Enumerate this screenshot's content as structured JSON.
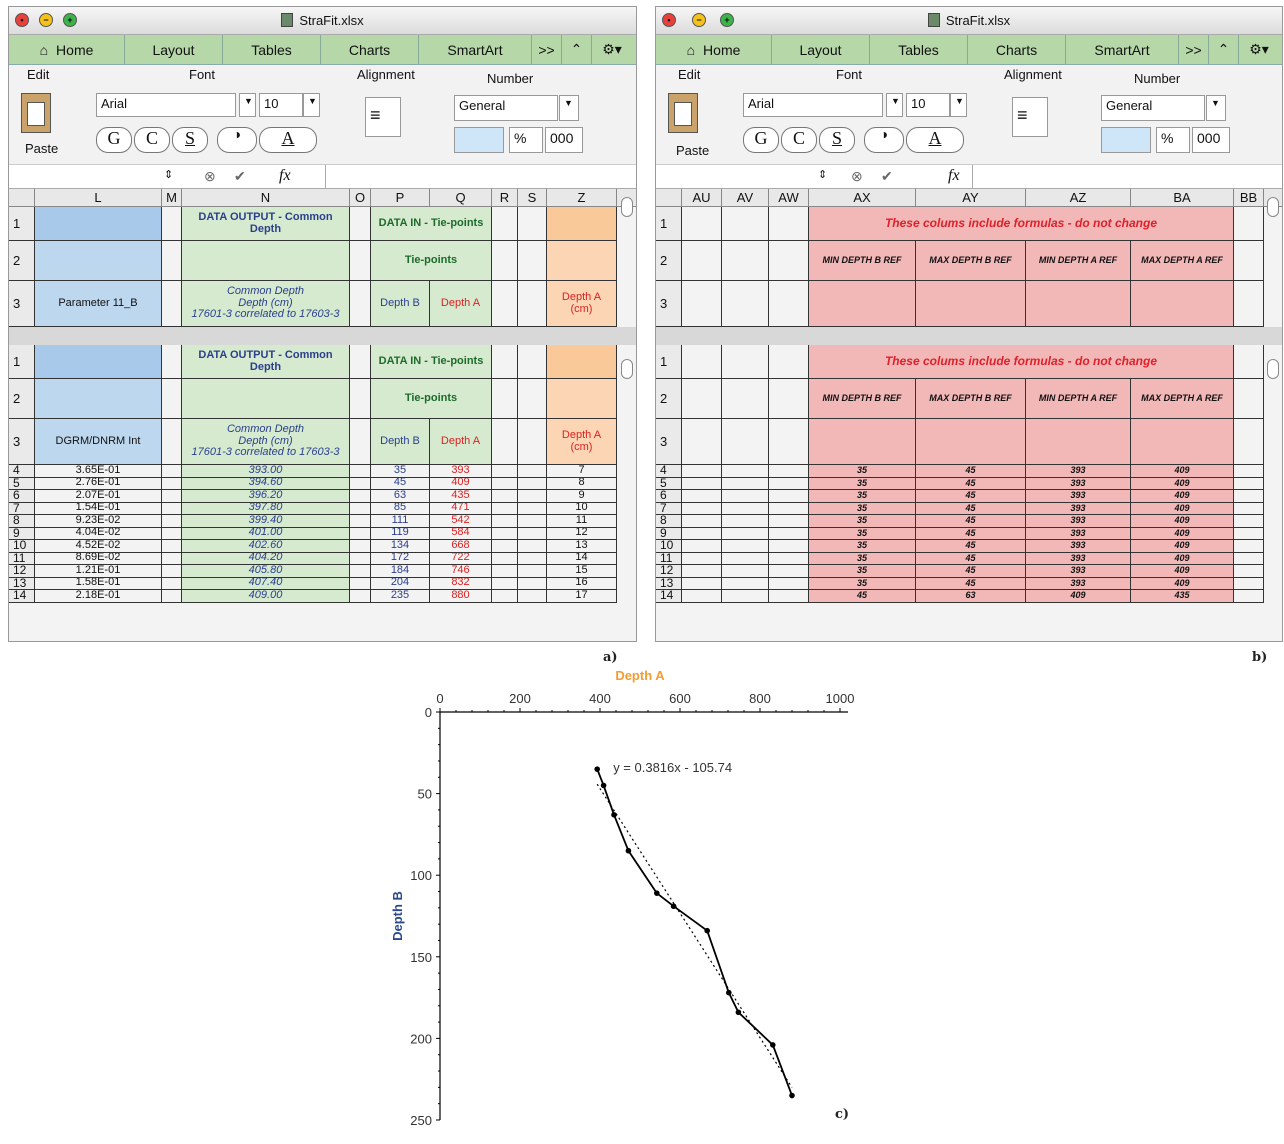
{
  "window_title": "StraFit.xlsx",
  "ribbon_tabs": [
    "Home",
    "Layout",
    "Tables",
    "Charts",
    "SmartArt"
  ],
  "ribbon": {
    "edit_label": "Edit",
    "font_label": "Font",
    "alignment_label": "Alignment",
    "number_label": "Number",
    "paste_label": "Paste",
    "font_name": "Arial",
    "font_size": "10",
    "number_format": "General",
    "percent": "%",
    "thousands": "000",
    "bold": "G",
    "italic": "C",
    "underline": "S",
    "font_color": "A",
    "fx": "fx"
  },
  "panel_a": {
    "label": "a)",
    "columns": [
      "L",
      "M",
      "N",
      "O",
      "P",
      "Q",
      "R",
      "S",
      "Z"
    ],
    "header_block_1": {
      "data_output": "DATA OUTPUT - Common Depth",
      "data_in": "DATA IN - Tie-points",
      "tie_points": "",
      "row3_l": "Parameter 11_B",
      "row3_n": "Common Depth\nDepth (cm)\n17601-3 correlated to 17603-3",
      "row3_p": "Depth B",
      "row3_q": "Depth A",
      "row3_z": "Depth A\n(cm)"
    },
    "header_block_2": {
      "data_output": "DATA OUTPUT - Common Depth",
      "data_in": "DATA IN - Tie-points",
      "tie_points": "Tie-points",
      "row3_l": "DGRM/DNRM Int",
      "row3_n": "Common Depth\nDepth (cm)\n17601-3 correlated to 17603-3",
      "row3_p": "Depth B",
      "row3_q": "Depth A",
      "row3_z": "Depth A\n(cm)"
    },
    "tie_points_top": "Tie-points",
    "rows": [
      {
        "r": "4",
        "l": "3.65E-01",
        "n": "393.00",
        "p": "35",
        "q": "393",
        "z": "7"
      },
      {
        "r": "5",
        "l": "2.76E-01",
        "n": "394.60",
        "p": "45",
        "q": "409",
        "z": "8"
      },
      {
        "r": "6",
        "l": "2.07E-01",
        "n": "396.20",
        "p": "63",
        "q": "435",
        "z": "9"
      },
      {
        "r": "7",
        "l": "1.54E-01",
        "n": "397.80",
        "p": "85",
        "q": "471",
        "z": "10"
      },
      {
        "r": "8",
        "l": "9.23E-02",
        "n": "399.40",
        "p": "111",
        "q": "542",
        "z": "11"
      },
      {
        "r": "9",
        "l": "4.04E-02",
        "n": "401.00",
        "p": "119",
        "q": "584",
        "z": "12"
      },
      {
        "r": "10",
        "l": "4.52E-02",
        "n": "402.60",
        "p": "134",
        "q": "668",
        "z": "13"
      },
      {
        "r": "11",
        "l": "8.69E-02",
        "n": "404.20",
        "p": "172",
        "q": "722",
        "z": "14"
      },
      {
        "r": "12",
        "l": "1.21E-01",
        "n": "405.80",
        "p": "184",
        "q": "746",
        "z": "15"
      },
      {
        "r": "13",
        "l": "1.58E-01",
        "n": "407.40",
        "p": "204",
        "q": "832",
        "z": "16"
      },
      {
        "r": "14",
        "l": "2.18E-01",
        "n": "409.00",
        "p": "235",
        "q": "880",
        "z": "17"
      }
    ]
  },
  "panel_b": {
    "label": "b)",
    "columns": [
      "AU",
      "AV",
      "AW",
      "AX",
      "AY",
      "AZ",
      "BA",
      "BB"
    ],
    "warning": "These colums include formulas - do not change",
    "headers": [
      "MIN DEPTH B REF",
      "MAX DEPTH B REF",
      "MIN DEPTH A REF",
      "MAX DEPTH A REF"
    ],
    "rows": [
      {
        "r": "4",
        "v": [
          "35",
          "45",
          "393",
          "409"
        ]
      },
      {
        "r": "5",
        "v": [
          "35",
          "45",
          "393",
          "409"
        ]
      },
      {
        "r": "6",
        "v": [
          "35",
          "45",
          "393",
          "409"
        ]
      },
      {
        "r": "7",
        "v": [
          "35",
          "45",
          "393",
          "409"
        ]
      },
      {
        "r": "8",
        "v": [
          "35",
          "45",
          "393",
          "409"
        ]
      },
      {
        "r": "9",
        "v": [
          "35",
          "45",
          "393",
          "409"
        ]
      },
      {
        "r": "10",
        "v": [
          "35",
          "45",
          "393",
          "409"
        ]
      },
      {
        "r": "11",
        "v": [
          "35",
          "45",
          "393",
          "409"
        ]
      },
      {
        "r": "12",
        "v": [
          "35",
          "45",
          "393",
          "409"
        ]
      },
      {
        "r": "13",
        "v": [
          "35",
          "45",
          "393",
          "409"
        ]
      },
      {
        "r": "14",
        "v": [
          "45",
          "63",
          "409",
          "435"
        ]
      }
    ]
  },
  "chart_data": {
    "type": "line",
    "label": "c)",
    "xlabel": "Depth A",
    "ylabel": "Depth B",
    "xlim": [
      0,
      1000
    ],
    "ylim": [
      0,
      250
    ],
    "x_ticks": [
      "0",
      "200",
      "400",
      "600",
      "800",
      "1000"
    ],
    "y_ticks": [
      "0",
      "50",
      "100",
      "150",
      "200",
      "250"
    ],
    "y_inverted": true,
    "x_axis_position": "top",
    "x": [
      393,
      409,
      435,
      471,
      542,
      584,
      668,
      722,
      746,
      832,
      880
    ],
    "y": [
      35,
      45,
      63,
      85,
      111,
      119,
      134,
      172,
      184,
      204,
      235
    ],
    "trendline": {
      "equation": "y = 0.3816x - 105.74",
      "slope": 0.3816,
      "intercept": -105.74
    },
    "colors": {
      "xlabel": "#f39c32",
      "ylabel": "#2b4a8c",
      "series": "#000000"
    }
  }
}
